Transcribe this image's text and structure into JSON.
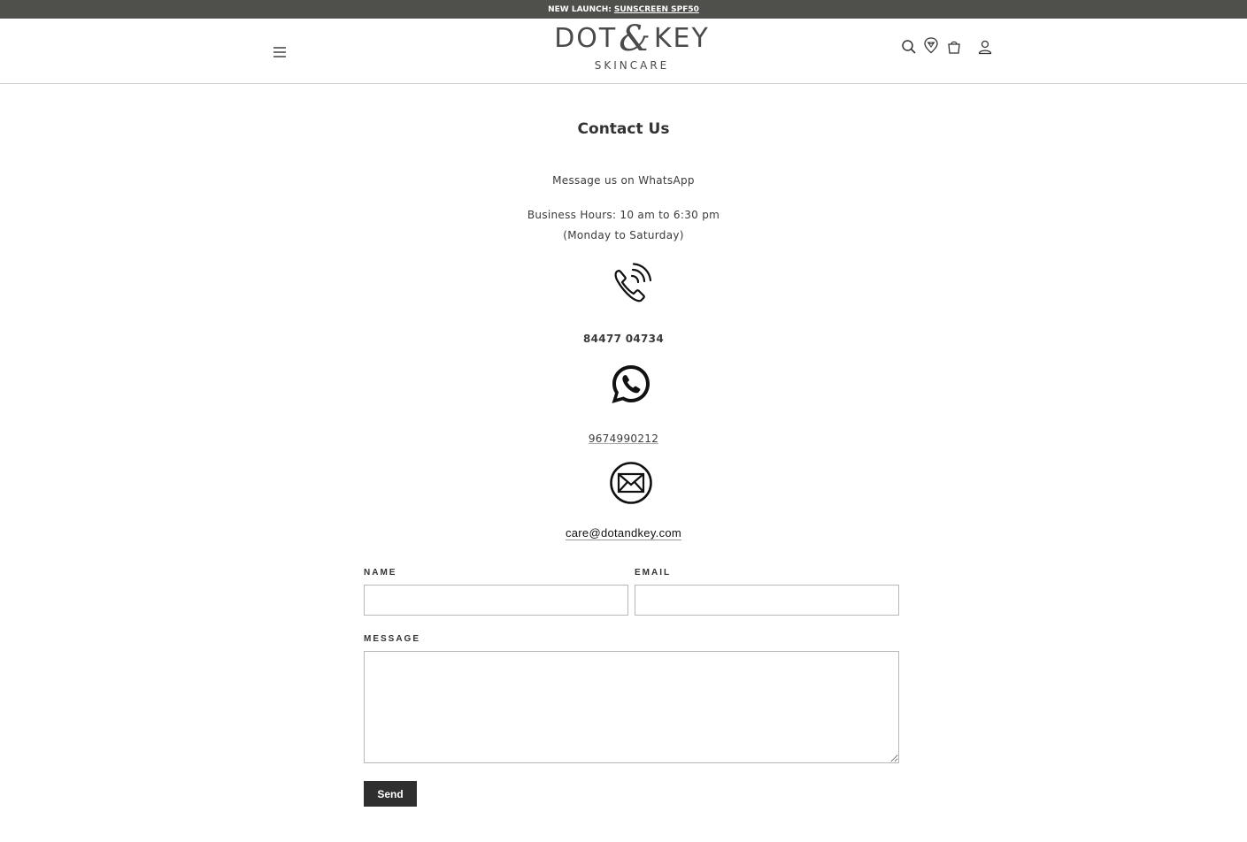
{
  "announcement": {
    "prefix": "NEW LAUNCH:",
    "link": "SUNSCREEN SPF50"
  },
  "header": {
    "logo_main_left": "DOT",
    "logo_amp": "&",
    "logo_main_right": "KEY",
    "logo_sub": "SKINCARE",
    "icons": [
      "menu-icon",
      "search-icon",
      "location-icon",
      "cart-icon",
      "account-icon"
    ]
  },
  "page": {
    "title": "Contact Us",
    "whatsapp_intro": "Message us on WhatsApp",
    "hours": "Business Hours: 10 am to 6:30 pm",
    "days": "(Monday to Saturday)",
    "phone_number": "84477 04734",
    "whatsapp_number": "9674990212",
    "email": "care@dotandkey.com"
  },
  "form": {
    "name_label": "NAME",
    "name_value": "",
    "email_label": "EMAIL",
    "email_value": "",
    "message_label": "MESSAGE",
    "message_value": "",
    "submit_label": "Send"
  },
  "colors": {
    "announcement_bg": "#4f4f4b",
    "button_bg": "#2f2f2f",
    "text": "#333333"
  }
}
